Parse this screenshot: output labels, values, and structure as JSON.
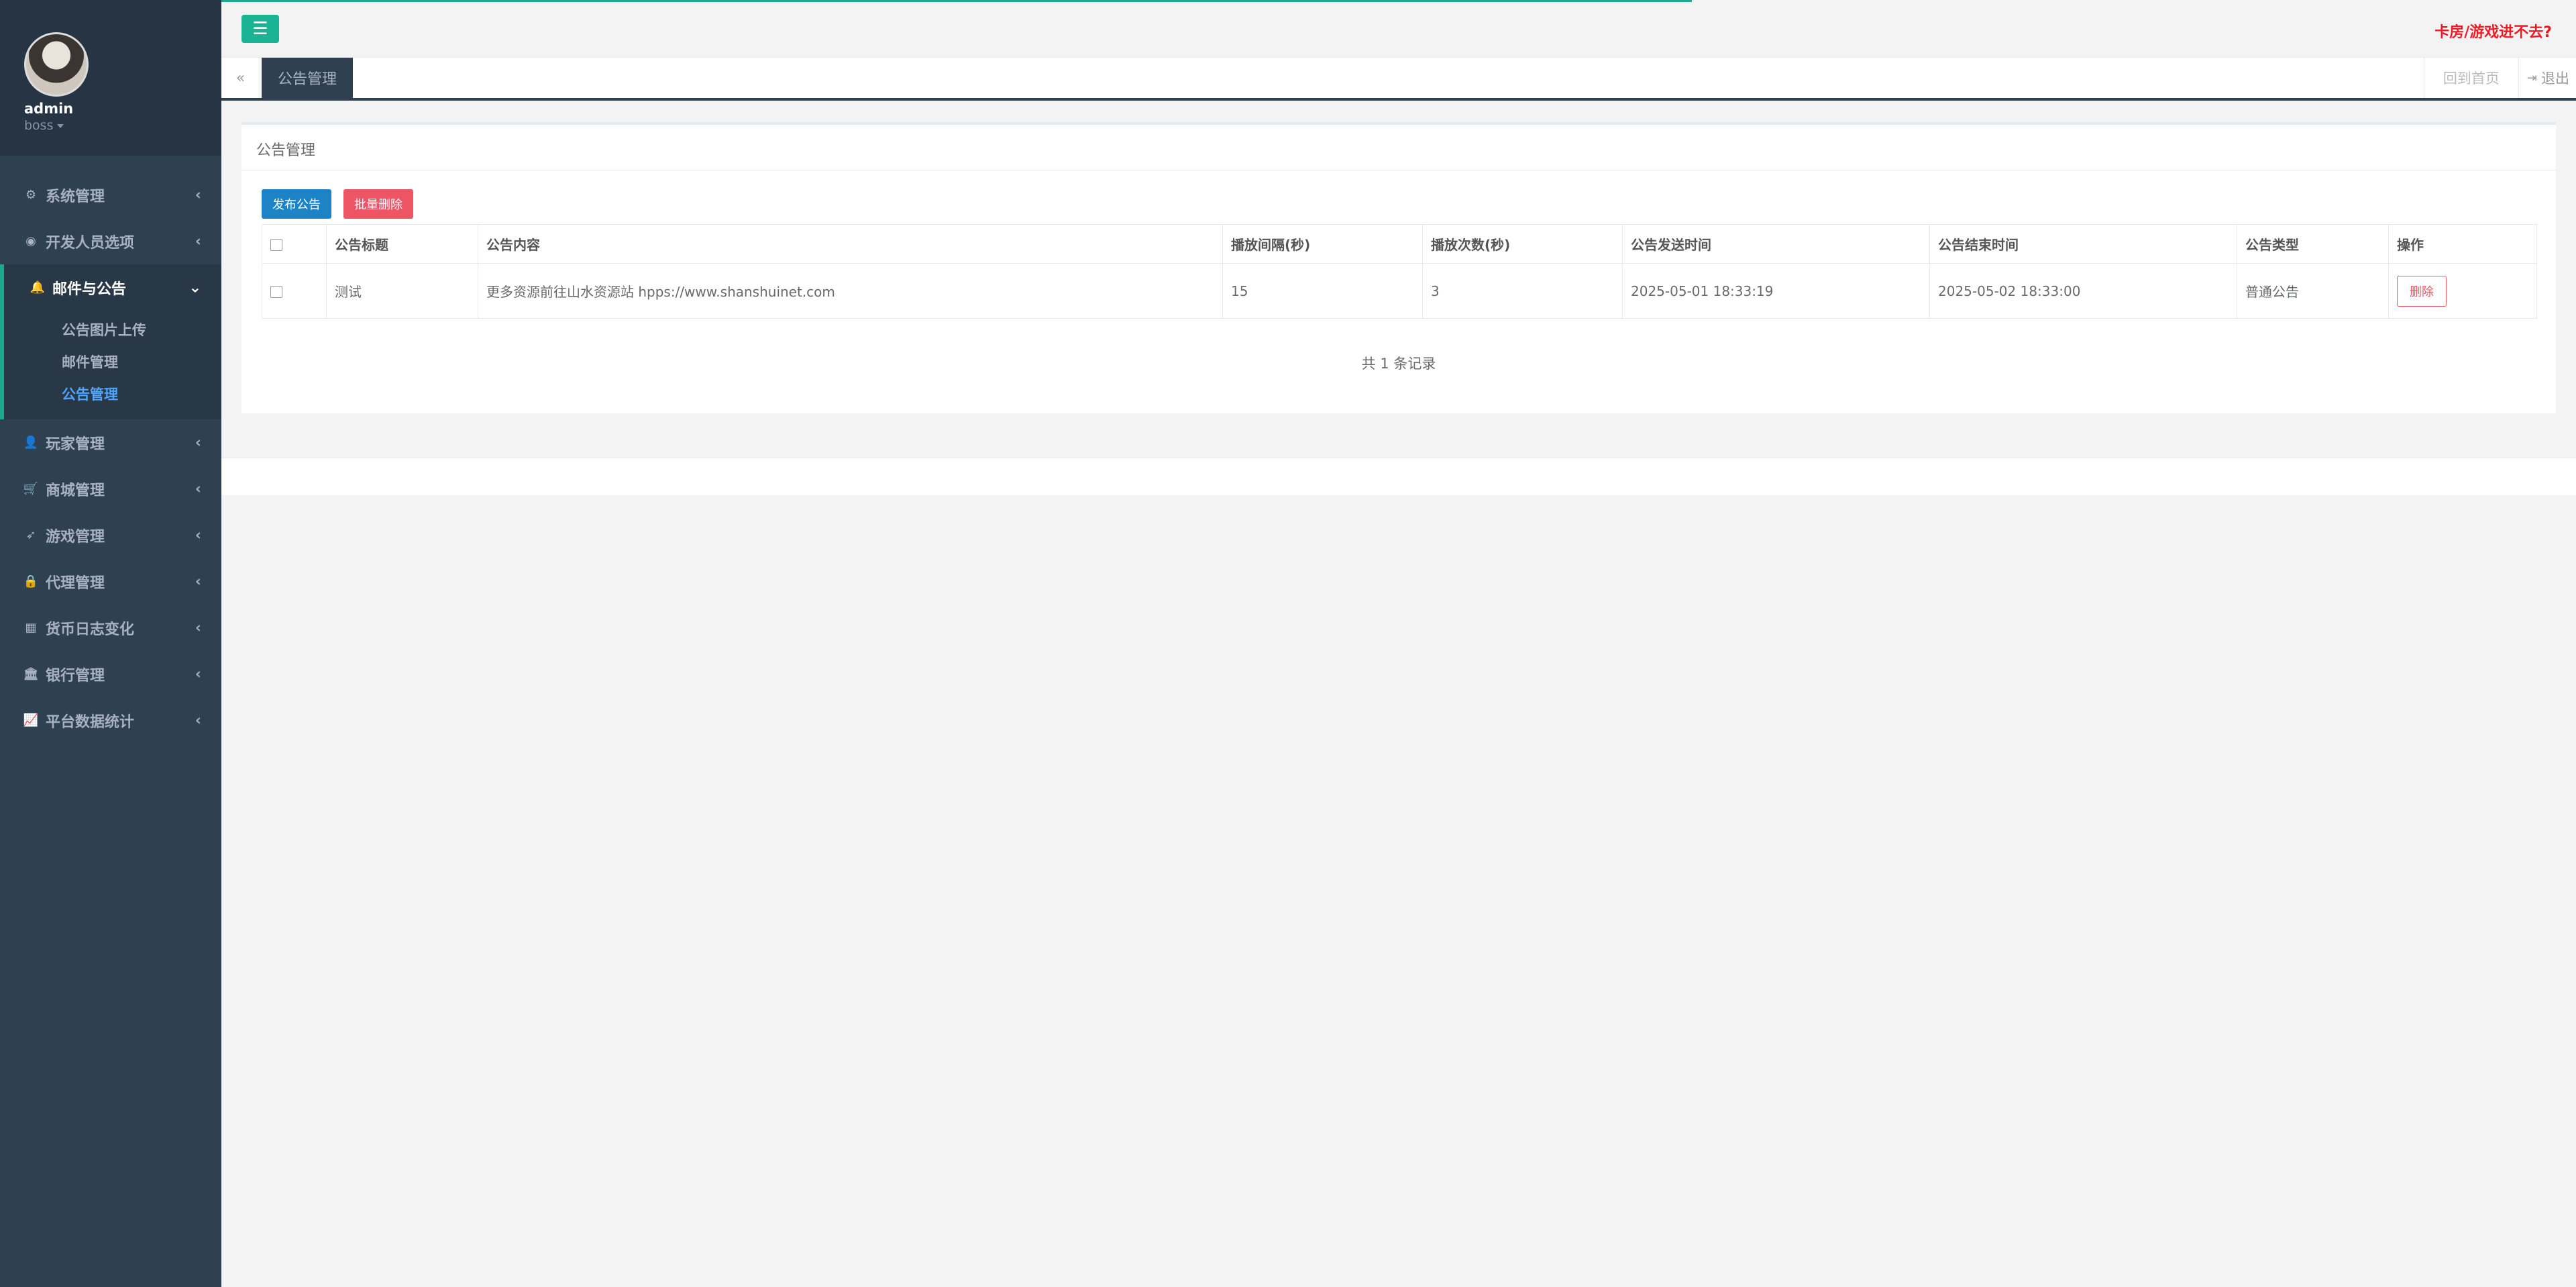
{
  "user": {
    "name": "admin",
    "role": "boss"
  },
  "sidebar": {
    "items": [
      {
        "label": "系统管理",
        "icon": "gears-icon"
      },
      {
        "label": "开发人员选项",
        "icon": "gamepad-icon"
      },
      {
        "label": "邮件与公告",
        "icon": "bell-icon",
        "active": true,
        "children": [
          {
            "label": "公告图片上传"
          },
          {
            "label": "邮件管理"
          },
          {
            "label": "公告管理",
            "current": true
          }
        ]
      },
      {
        "label": "玩家管理",
        "icon": "user-icon"
      },
      {
        "label": "商城管理",
        "icon": "cart-icon"
      },
      {
        "label": "游戏管理",
        "icon": "rocket-icon"
      },
      {
        "label": "代理管理",
        "icon": "lock-icon"
      },
      {
        "label": "货币日志变化",
        "icon": "calendar-icon"
      },
      {
        "label": "银行管理",
        "icon": "bank-icon"
      },
      {
        "label": "平台数据统计",
        "icon": "line-chart-icon"
      }
    ]
  },
  "topbar": {
    "notice_link": "卡房/游戏进不去?"
  },
  "tabs": {
    "active": "公告管理",
    "home": "回到首页",
    "logout": "退出"
  },
  "panel": {
    "title": "公告管理",
    "publish_button": "发布公告",
    "batch_delete_button": "批量删除"
  },
  "table": {
    "headers": [
      "公告标题",
      "公告内容",
      "播放间隔(秒)",
      "播放次数(秒)",
      "公告发送时间",
      "公告结束时间",
      "公告类型",
      "操作"
    ],
    "rows": [
      {
        "title": "测试",
        "content": "更多资源前往山水资源站 hpps://www.shanshuinet.com",
        "interval": "15",
        "count": "3",
        "start": "2025-05-01 18:33:19",
        "end": "2025-05-02 18:33:00",
        "type": "普通公告",
        "action": "删除"
      }
    ],
    "record_count": "共 1 条记录"
  },
  "colors": {
    "sidebar_bg": "#2f4050",
    "accent": "#1ab394",
    "primary": "#1c84c6",
    "danger": "#ed5565"
  }
}
